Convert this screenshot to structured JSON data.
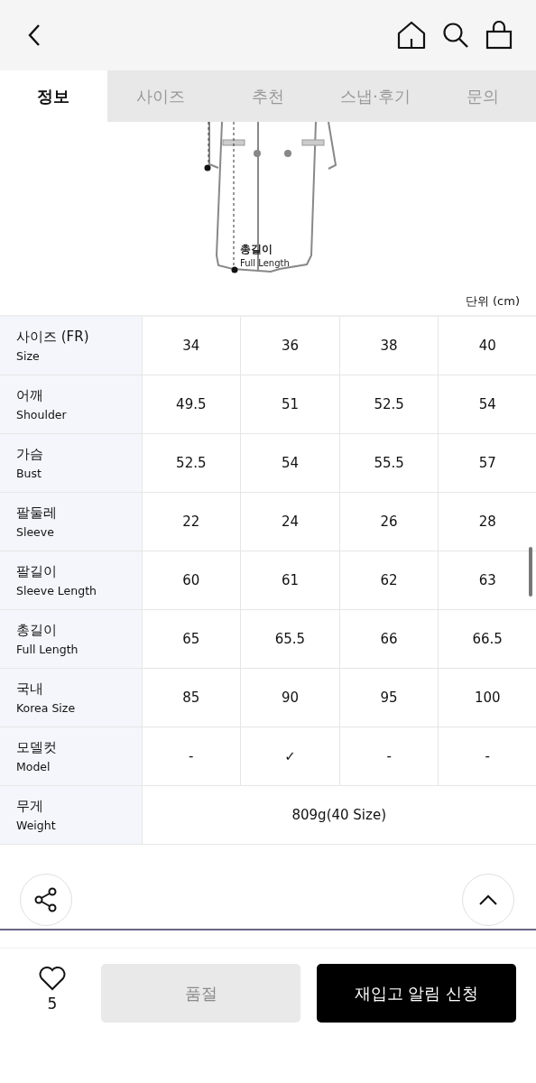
{
  "tabs": [
    {
      "label": "정보",
      "selected": true
    },
    {
      "label": "사이즈",
      "selected": false
    },
    {
      "label": "추천",
      "selected": false
    },
    {
      "label": "스냅·후기",
      "selected": false
    },
    {
      "label": "문의",
      "selected": false
    }
  ],
  "diagram": {
    "label_ko": "총길이",
    "label_en": "Full Length"
  },
  "unit": "단위 (cm)",
  "size_table": {
    "rows": [
      {
        "label_ko": "사이즈 (FR)",
        "label_en": "Size",
        "values": [
          "34",
          "36",
          "38",
          "40"
        ]
      },
      {
        "label_ko": "어깨",
        "label_en": "Shoulder",
        "values": [
          "49.5",
          "51",
          "52.5",
          "54"
        ]
      },
      {
        "label_ko": "가슴",
        "label_en": "Bust",
        "values": [
          "52.5",
          "54",
          "55.5",
          "57"
        ]
      },
      {
        "label_ko": "팔둘레",
        "label_en": "Sleeve",
        "values": [
          "22",
          "24",
          "26",
          "28"
        ]
      },
      {
        "label_ko": "팔길이",
        "label_en": "Sleeve Length",
        "values": [
          "60",
          "61",
          "62",
          "63"
        ]
      },
      {
        "label_ko": "총길이",
        "label_en": "Full Length",
        "values": [
          "65",
          "65.5",
          "66",
          "66.5"
        ]
      },
      {
        "label_ko": "국내",
        "label_en": "Korea Size",
        "values": [
          "85",
          "90",
          "95",
          "100"
        ]
      },
      {
        "label_ko": "모델컷",
        "label_en": "Model",
        "values": [
          "-",
          "✓",
          "-",
          "-"
        ]
      },
      {
        "label_ko": "무게",
        "label_en": "Weight",
        "values": [
          "809g(40 Size)"
        ]
      }
    ]
  },
  "bottom_bar": {
    "likes": "5",
    "sold_out_button": "품절",
    "restock_button": "재입고 알림 신청"
  }
}
